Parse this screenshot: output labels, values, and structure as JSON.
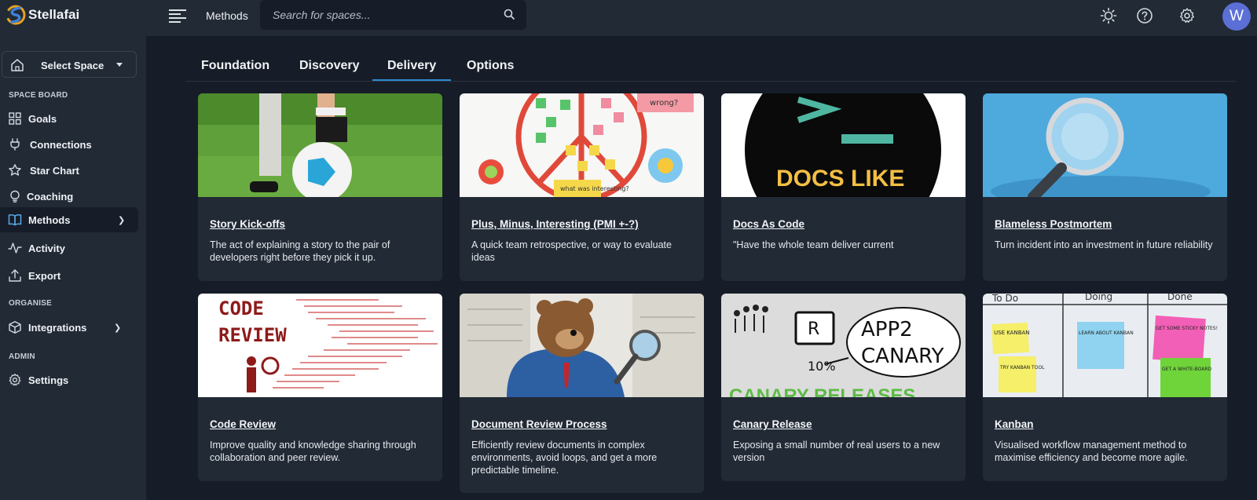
{
  "app": {
    "brand": "Stellafai"
  },
  "header": {
    "breadcrumb": "Methods",
    "search_placeholder": "Search for spaces...",
    "avatar_initial": "W"
  },
  "sidebar": {
    "space_select_label": "Select Space",
    "section_space_board": "SPACE BOARD",
    "section_organise": "ORGANISE",
    "section_admin": "ADMIN",
    "items": [
      {
        "label": "Goals",
        "icon": "grid-icon"
      },
      {
        "label": "Connections",
        "icon": "plug-icon"
      },
      {
        "label": "Star Chart",
        "icon": "star-icon"
      },
      {
        "label": "Coaching",
        "icon": "lightbulb-icon"
      },
      {
        "label": "Methods",
        "icon": "book-icon",
        "active": true
      },
      {
        "label": "Activity",
        "icon": "activity-icon"
      },
      {
        "label": "Export",
        "icon": "upload-icon"
      },
      {
        "label": "Integrations",
        "icon": "box-icon"
      },
      {
        "label": "Settings",
        "icon": "gear-icon"
      }
    ]
  },
  "tabs": [
    {
      "label": "Foundation"
    },
    {
      "label": "Discovery"
    },
    {
      "label": "Delivery",
      "active": true
    },
    {
      "label": "Options"
    }
  ],
  "cards": [
    {
      "title": "Story Kick-offs",
      "desc": "The act of explaining a story to the pair of developers right before they pick it up."
    },
    {
      "title": "Plus, Minus, Interesting (PMI +-?)",
      "desc": "A quick team retrospective, or way to evaluate ideas",
      "img_text_1": "wrong?",
      "img_text_2": "what was interesting?"
    },
    {
      "title": "Docs As Code",
      "desc": "\"Have the whole team deliver current",
      "img_text_1": "DOCS LIKE"
    },
    {
      "title": "Blameless Postmortem",
      "desc": "Turn incident into an investment in future reliability"
    },
    {
      "title": "Code Review",
      "desc": "Improve quality and knowledge sharing through collaboration and peer review.",
      "img_text_1": "CODE",
      "img_text_2": "REVIEW"
    },
    {
      "title": "Document Review Process",
      "desc": "Efficiently review documents in complex environments, avoid loops, and get a more predictable timeline."
    },
    {
      "title": "Canary Release",
      "desc": "Exposing a small number of real users to a new version",
      "img_text_1": "APP2",
      "img_text_2": "CANARY",
      "img_text_3": "10%",
      "img_text_4": "R",
      "img_text_5": "CANARY RELEASES"
    },
    {
      "title": "Kanban",
      "desc": "Visualised workflow management method to maximise efficiency and become more agile.",
      "img_text_1": "To Do",
      "img_text_2": "Doing",
      "img_text_3": "Done",
      "img_text_4": "USE KANBAN",
      "img_text_5": "TRY KANBAN TOOL",
      "img_text_6": "LEARN ABOUT KANBAN",
      "img_text_7": "GET SOME STICKY NOTES!",
      "img_text_8": "GET A WHITE-BOARD"
    }
  ]
}
